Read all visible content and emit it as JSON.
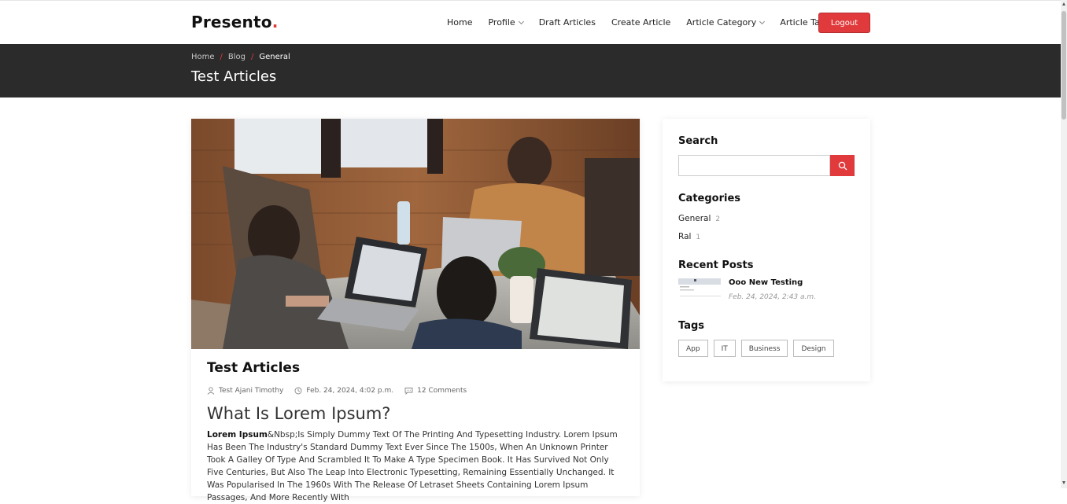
{
  "brand": {
    "name": "Presento",
    "dot": "."
  },
  "nav": {
    "home": "Home",
    "profile": "Profile",
    "draft_articles": "Draft Articles",
    "create_article": "Create Article",
    "article_category": "Article Category",
    "article_tags": "Article Tags",
    "logout": "Logout"
  },
  "breadcrumb": {
    "items": [
      "Home",
      "Blog",
      "General"
    ],
    "separator": "/",
    "title": "Test Articles"
  },
  "article": {
    "title": "Test Articles",
    "author": "Test Ajani Timothy",
    "date": "Feb. 24, 2024, 4:02 p.m.",
    "comments": "12 Comments",
    "heading": "What Is Lorem Ipsum?",
    "lead_bold": "Lorem Ipsum",
    "body": "&Nbsp;Is Simply Dummy Text Of The Printing And Typesetting Industry. Lorem Ipsum Has Been The Industry's Standard Dummy Text Ever Since The 1500s, When An Unknown Printer Took A Galley Of Type And Scrambled It To Make A Type Specimen Book. It Has Survived Not Only Five Centuries, But Also The Leap Into Electronic Typesetting, Remaining Essentially Unchanged. It Was Popularised In The 1960s With The Release Of Letraset Sheets Containing Lorem Ipsum Passages, And More Recently With"
  },
  "sidebar": {
    "search_heading": "Search",
    "categories_heading": "Categories",
    "categories": [
      {
        "name": "General",
        "count": "2"
      },
      {
        "name": "Ral",
        "count": "1"
      }
    ],
    "recent_heading": "Recent Posts",
    "recent": {
      "title": "Ooo New Testing",
      "date": "Feb. 24, 2024, 2:43 a.m."
    },
    "tags_heading": "Tags",
    "tags": [
      "App",
      "IT",
      "Business",
      "Design"
    ]
  },
  "colors": {
    "accent": "#e03a3c",
    "band": "#2b2b2b"
  }
}
